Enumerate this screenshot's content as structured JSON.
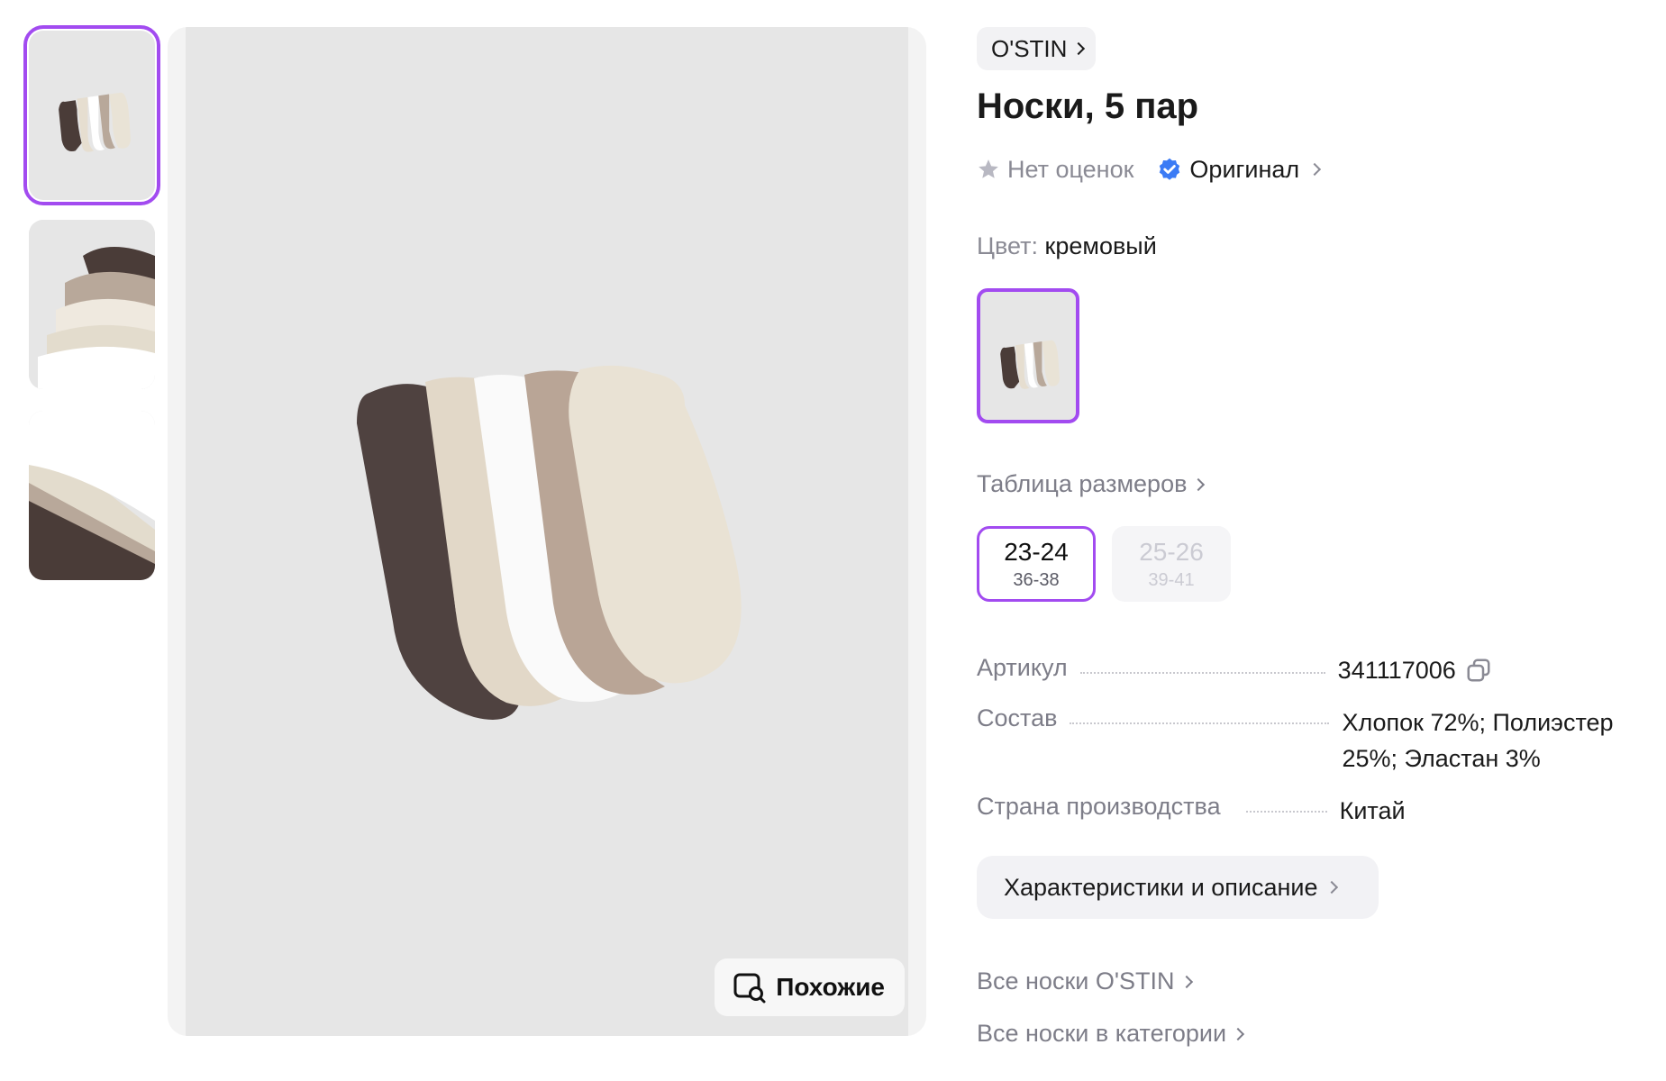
{
  "gallery": {
    "thumbnails": [
      {
        "alt": "",
        "selected": true
      },
      {
        "alt": "",
        "selected": false
      },
      {
        "alt": "",
        "selected": false
      }
    ],
    "similar_label": "Похожие"
  },
  "product": {
    "brand": "O'STIN",
    "title": "Носки, 5 пар",
    "rating_text": "Нет оценок",
    "original_label": "Оригинал",
    "color_label": "Цвет:",
    "color_value": "кремовый",
    "size_table_label": "Таблица размеров",
    "sizes": [
      {
        "main": "23-24",
        "sub": "36-38",
        "selected": true,
        "available": true
      },
      {
        "main": "25-26",
        "sub": "39-41",
        "selected": false,
        "available": false
      }
    ],
    "specs": [
      {
        "key": "Артикул",
        "value": "341117006"
      },
      {
        "key": "Состав",
        "value": "Хлопок 72%; Полиэстер 25%; Эластан 3%"
      },
      {
        "key": "Страна производства",
        "value": "Китай"
      }
    ],
    "description_button": "Характеристики и описание",
    "links": [
      "Все носки O'STIN",
      "Все носки в категории"
    ]
  },
  "colors": {
    "accent": "#a24bf0",
    "verified_badge": "#3b7bf5",
    "star": "#b8b8c2",
    "muted_text": "#7d7d88"
  },
  "icons": {
    "rating": "star-icon",
    "original": "verified-badge-icon",
    "copy": "copy-icon",
    "similar": "image-search-icon"
  }
}
